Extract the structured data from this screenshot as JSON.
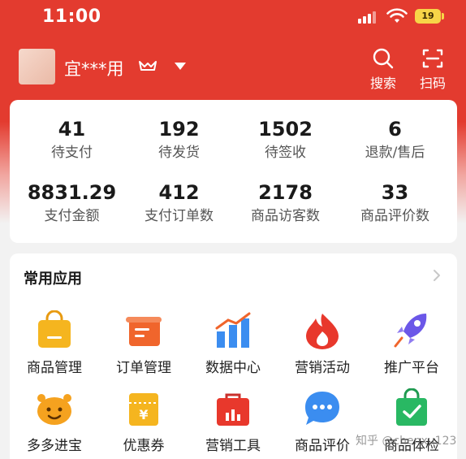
{
  "status_bar": {
    "time": "11:00",
    "battery": "19"
  },
  "header": {
    "store_name": "宜***用",
    "search_label": "搜索",
    "scan_label": "扫码"
  },
  "stats": [
    {
      "value": "41",
      "label": "待支付"
    },
    {
      "value": "192",
      "label": "待发货"
    },
    {
      "value": "1502",
      "label": "待签收"
    },
    {
      "value": "6",
      "label": "退款/售后"
    },
    {
      "value": "8831.29",
      "label": "支付金额"
    },
    {
      "value": "412",
      "label": "支付订单数"
    },
    {
      "value": "2178",
      "label": "商品访客数"
    },
    {
      "value": "33",
      "label": "商品评价数"
    }
  ],
  "apps_section": {
    "title": "常用应用",
    "items": [
      {
        "label": "商品管理",
        "icon": "shopping-bag-icon"
      },
      {
        "label": "订单管理",
        "icon": "scroll-icon"
      },
      {
        "label": "数据中心",
        "icon": "bar-chart-icon"
      },
      {
        "label": "营销活动",
        "icon": "flame-icon"
      },
      {
        "label": "推广平台",
        "icon": "rocket-icon"
      },
      {
        "label": "多多进宝",
        "icon": "treasure-icon"
      },
      {
        "label": "优惠券",
        "icon": "coupon-icon"
      },
      {
        "label": "营销工具",
        "icon": "toolbox-icon"
      },
      {
        "label": "商品评价",
        "icon": "chat-bubble-icon"
      },
      {
        "label": "商品体检",
        "icon": "check-bag-icon"
      }
    ]
  },
  "watermark": "知乎 @chenxu123",
  "colors": {
    "brand_red": "#e33b2f",
    "icon_yellow": "#f5b51f",
    "icon_orange": "#f0652c",
    "icon_blue": "#3b8df0",
    "icon_purple": "#6b57e8",
    "icon_green": "#29b863"
  }
}
